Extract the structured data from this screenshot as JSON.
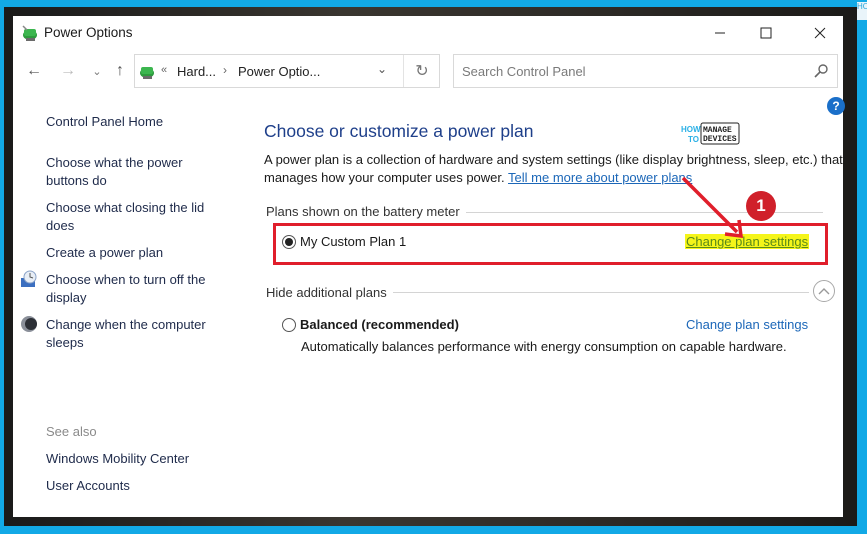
{
  "window": {
    "title": "Power Options",
    "minimize_icon": "minimize-icon",
    "maximize_icon": "maximize-icon",
    "close_icon": "close-icon"
  },
  "nav": {
    "back_icon": "arrow-left-icon",
    "forward_icon": "arrow-right-icon",
    "recent_icon": "chevron-down-icon",
    "up_icon": "arrow-up-icon",
    "address": {
      "overflow": "«",
      "crumbs": [
        "Hard...",
        "Power Optio..."
      ],
      "separator": "›"
    },
    "refresh_icon": "refresh-icon",
    "search_placeholder": "Search Control Panel"
  },
  "help": {
    "label": "?"
  },
  "sidebar": {
    "items": [
      {
        "label": "Control Panel Home",
        "icon": null
      },
      {
        "label": "Choose what the power buttons do",
        "icon": null
      },
      {
        "label": "Choose what closing the lid does",
        "icon": null
      },
      {
        "label": "Create a power plan",
        "icon": null
      },
      {
        "label": "Choose when to turn off the display",
        "icon": "display-clock-icon"
      },
      {
        "label": "Change when the computer sleeps",
        "icon": "sleep-moon-icon"
      }
    ],
    "see_also_label": "See also",
    "see_also": [
      {
        "label": "Windows Mobility Center"
      },
      {
        "label": "User Accounts"
      }
    ]
  },
  "main": {
    "title": "Choose or customize a power plan",
    "description": "A power plan is a collection of hardware and system settings (like display brightness, sleep, etc.) that manages how your computer uses power.",
    "learn_more_link": "Tell me more about power plans",
    "battery_section": {
      "label": "Plans shown on the battery meter",
      "plans": [
        {
          "name": "My Custom Plan 1",
          "selected": true,
          "change_link": "Change plan settings",
          "highlighted": true
        }
      ]
    },
    "additional_section": {
      "label": "Hide additional plans",
      "toggle_icon": "chevron-up-icon",
      "plans": [
        {
          "name": "Balanced (recommended)",
          "selected": false,
          "change_link": "Change plan settings",
          "description": "Automatically balances performance with energy consumption on capable hardware."
        }
      ]
    }
  },
  "annotation": {
    "step_number": "1",
    "colors": {
      "box": "#e01e2b",
      "highlight": "#f5f51a"
    }
  },
  "watermark": {
    "how": "HOW",
    "to": "TO",
    "manage": "MANAGE",
    "devices": "DEVICES"
  }
}
